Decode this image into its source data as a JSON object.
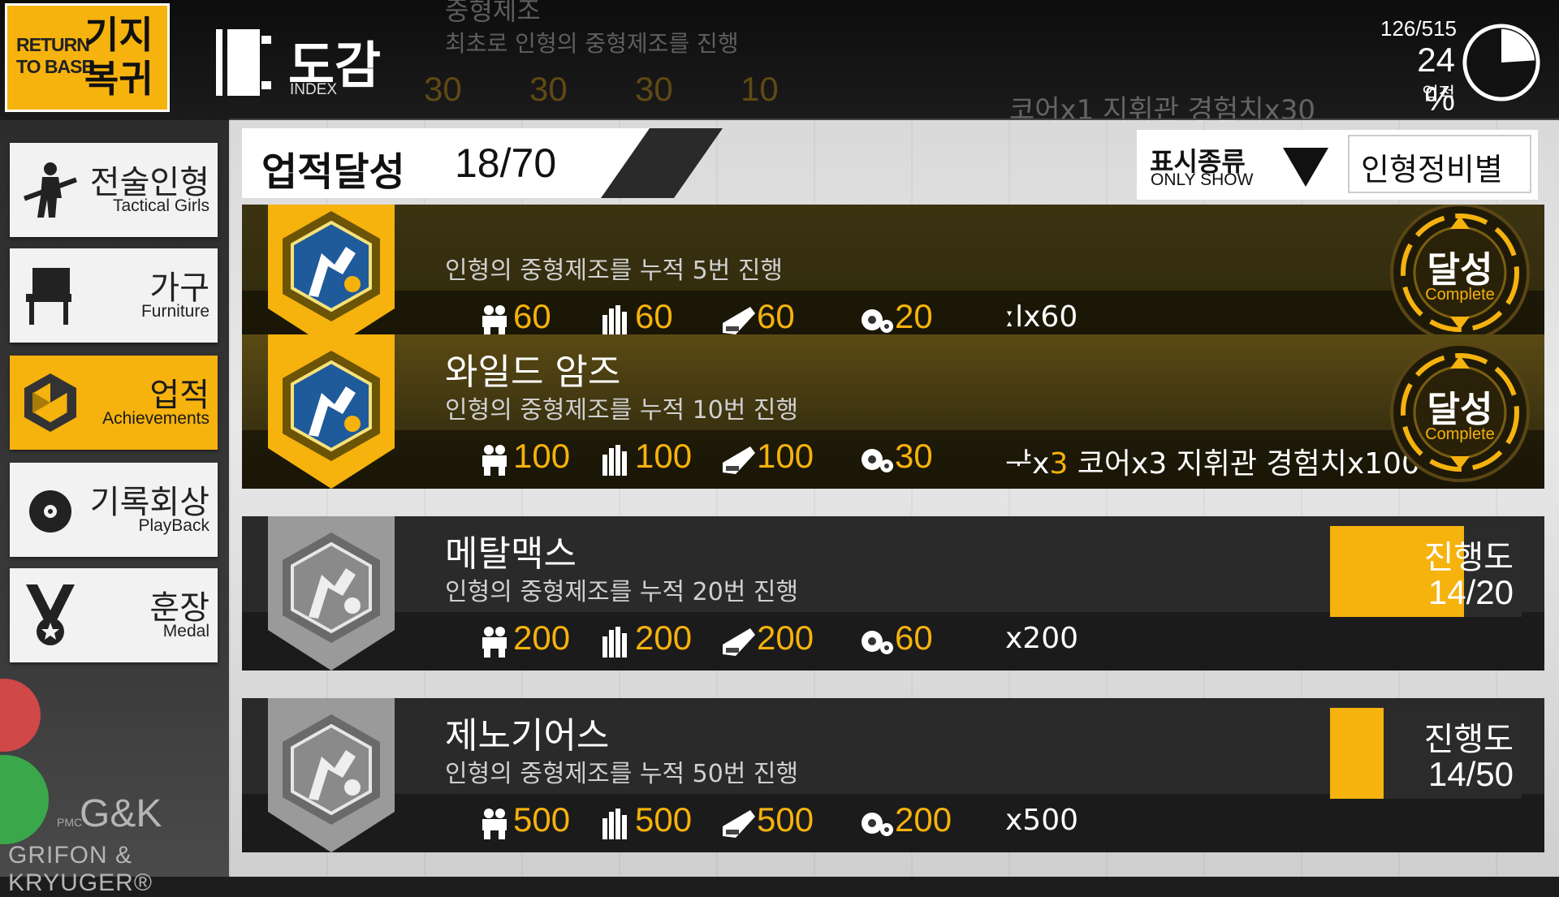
{
  "header": {
    "return_base": {
      "en_line1": "RETURN",
      "en_line2": "TO BASE",
      "ko_line1": "기지",
      "ko_line2": "복귀"
    },
    "title": {
      "ko": "도감",
      "en": "INDEX"
    },
    "progress": {
      "count": "126/515",
      "percent": "24 %",
      "label": "업적",
      "fraction": 0.24
    }
  },
  "sidebar": {
    "items": [
      {
        "ko": "전술인형",
        "en": "Tactical Girls",
        "icon": "soldier-icon"
      },
      {
        "ko": "가구",
        "en": "Furniture",
        "icon": "chair-icon"
      },
      {
        "ko": "업적",
        "en": "Achievements",
        "icon": "achievement-icon",
        "active": true
      },
      {
        "ko": "기록회상",
        "en": "PlayBack",
        "icon": "disc-icon"
      },
      {
        "ko": "훈장",
        "en": "Medal",
        "icon": "medal-icon"
      }
    ],
    "logo": {
      "pmc": "PMC",
      "mark": "G&K",
      "name": "GRIFON & KRYUGER®"
    }
  },
  "achievements_header": {
    "label": "업적달성",
    "count": "18/70"
  },
  "filter": {
    "label_ko": "표시종류",
    "label_en": "ONLY SHOW",
    "selected": "인형정비별"
  },
  "faded_row": {
    "title": "중형제조",
    "desc": "최초로 인형의 중형제조를 진행",
    "resources": [
      "30",
      "30",
      "30",
      "10"
    ],
    "reward": "코어x1  지휘관 경험치x30"
  },
  "rows": [
    {
      "name": "",
      "desc": "인형의 중형제조를 누적 5번 진행",
      "resources": [
        "60",
        "60",
        "60",
        "20"
      ],
      "reward_pre": "ːlx60",
      "reward_hl": "",
      "reward_post": "",
      "complete": true,
      "complete_ko": "달성",
      "complete_en": "Complete"
    },
    {
      "name": "와일드 암즈",
      "desc": "인형의 중형제조를 누적 10번 진행",
      "resources": [
        "100",
        "100",
        "100",
        "30"
      ],
      "reward_pre": "ᅷx",
      "reward_hl": "3",
      "reward_post": "  코어x3  지휘관 경험치x100",
      "complete": true,
      "complete_ko": "달성",
      "complete_en": "Complete"
    },
    {
      "name": "메탈맥스",
      "desc": "인형의 중형제조를 누적 20번 진행",
      "resources": [
        "200",
        "200",
        "200",
        "60"
      ],
      "reward_pre": "x200",
      "reward_hl": "",
      "reward_post": "",
      "complete": false,
      "progress_label": "진행도",
      "progress_value": "14/20",
      "progress_fraction": 0.7
    },
    {
      "name": "제노기어스",
      "desc": "인형의 중형제조를 누적 50번 진행",
      "resources": [
        "500",
        "500",
        "500",
        "200"
      ],
      "reward_pre": "x500",
      "reward_hl": "",
      "reward_post": "",
      "complete": false,
      "progress_label": "진행도",
      "progress_value": "14/50",
      "progress_fraction": 0.28
    }
  ],
  "resource_icons": [
    "manpower-icon",
    "ammo-icon",
    "ration-icon",
    "parts-icon"
  ],
  "colors": {
    "accent": "#f6b20d",
    "complete_bg": "#3a3210",
    "row_bg": "#2a2a2a"
  }
}
